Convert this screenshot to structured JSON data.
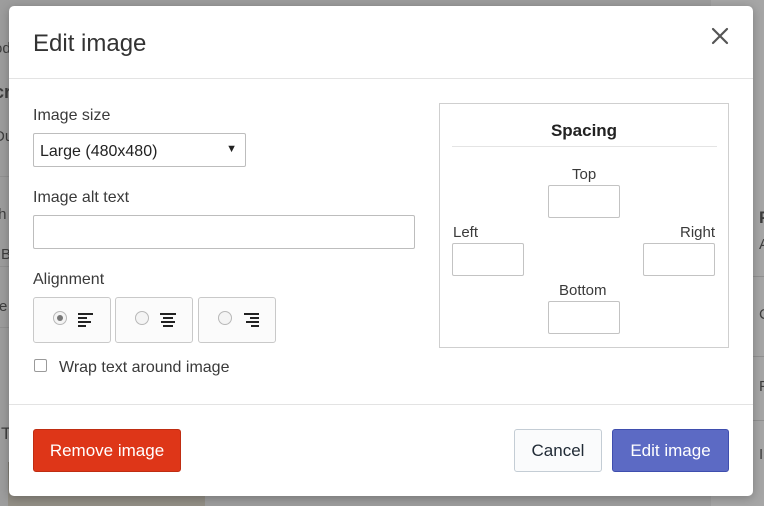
{
  "background": {
    "left_fragments": [
      "od",
      "cr",
      "Du",
      "th",
      "B",
      "e",
      "T"
    ],
    "right_fragments": [
      "P",
      "A",
      "C",
      "F",
      "I"
    ]
  },
  "modal": {
    "title": "Edit image",
    "close_icon": "close-icon",
    "image_size": {
      "label": "Image size",
      "selected": "Large (480x480)",
      "arrow": "▼"
    },
    "alt_text": {
      "label": "Image alt text",
      "value": ""
    },
    "alignment": {
      "label": "Alignment",
      "options": [
        {
          "name": "left",
          "checked": true,
          "icon": "align-left-icon"
        },
        {
          "name": "center",
          "checked": false,
          "icon": "align-center-icon"
        },
        {
          "name": "right",
          "checked": false,
          "icon": "align-right-icon"
        }
      ]
    },
    "wrap_text": {
      "label": "Wrap text around image",
      "checked": false
    },
    "spacing": {
      "title": "Spacing",
      "top": "Top",
      "left": "Left",
      "right": "Right",
      "bottom": "Bottom"
    },
    "footer": {
      "remove": "Remove image",
      "cancel": "Cancel",
      "submit": "Edit image"
    }
  },
  "colors": {
    "destructive": "#de3618",
    "primary": "#5c6ac4",
    "overlay": "#9d9d9d"
  }
}
